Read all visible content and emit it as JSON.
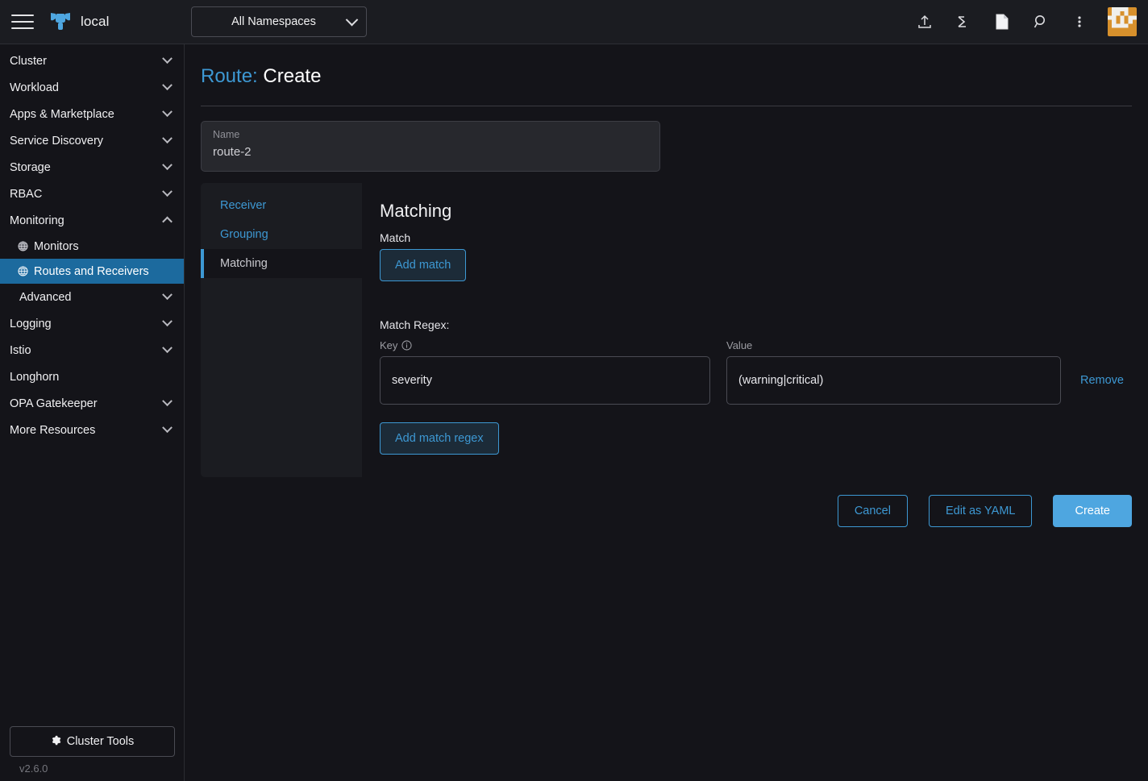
{
  "header": {
    "cluster_name": "local",
    "namespace_selector": {
      "value": "All Namespaces"
    },
    "icons": [
      {
        "name": "import-yaml-icon",
        "title": "Import YAML"
      },
      {
        "name": "kubectl-shell-icon",
        "title": "Kubectl Shell"
      },
      {
        "name": "docs-icon",
        "title": "Docs"
      },
      {
        "name": "search-icon",
        "title": "Search"
      },
      {
        "name": "overflow-menu-icon",
        "title": "More"
      }
    ],
    "avatar_alt": "user-avatar"
  },
  "sidebar": {
    "groups": [
      {
        "label": "Cluster",
        "expanded": false
      },
      {
        "label": "Workload",
        "expanded": false
      },
      {
        "label": "Apps & Marketplace",
        "expanded": false
      },
      {
        "label": "Service Discovery",
        "expanded": false
      },
      {
        "label": "Storage",
        "expanded": false
      },
      {
        "label": "RBAC",
        "expanded": false
      },
      {
        "label": "Monitoring",
        "expanded": true
      }
    ],
    "monitoring_items": [
      {
        "label": "Monitors",
        "active": false
      },
      {
        "label": "Routes and Receivers",
        "active": true
      }
    ],
    "groups_after": [
      {
        "label": "Advanced",
        "expanded": false,
        "sub": true
      },
      {
        "label": "Logging",
        "expanded": false
      },
      {
        "label": "Istio",
        "expanded": false
      },
      {
        "label": "Longhorn",
        "expanded": null
      },
      {
        "label": "OPA Gatekeeper",
        "expanded": false
      },
      {
        "label": "More Resources",
        "expanded": false
      }
    ],
    "cluster_tools_label": "Cluster Tools",
    "version": "v2.6.0"
  },
  "page": {
    "title_type": "Route:",
    "title_action": "Create",
    "name_field": {
      "label": "Name",
      "value": "route-2"
    }
  },
  "tabs": [
    {
      "label": "Receiver",
      "active": false
    },
    {
      "label": "Grouping",
      "active": false
    },
    {
      "label": "Matching",
      "active": true
    }
  ],
  "matching": {
    "heading": "Matching",
    "match_label": "Match",
    "add_match_label": "Add match",
    "regex_title": "Match Regex:",
    "key_header": "Key",
    "value_header": "Value",
    "rows": [
      {
        "key": "severity",
        "value": "(warning|critical)",
        "remove_label": "Remove"
      }
    ],
    "add_match_regex_label": "Add match regex"
  },
  "footer_actions": {
    "cancel": "Cancel",
    "edit_yaml": "Edit as YAML",
    "create": "Create"
  },
  "colors": {
    "accent_blue": "#3d98d3",
    "primary_button": "#4ea6e0",
    "active_nav": "#1c6a9e",
    "avatar_orange": "#d7902c",
    "background": "#141419",
    "panel": "#1b1c21"
  }
}
